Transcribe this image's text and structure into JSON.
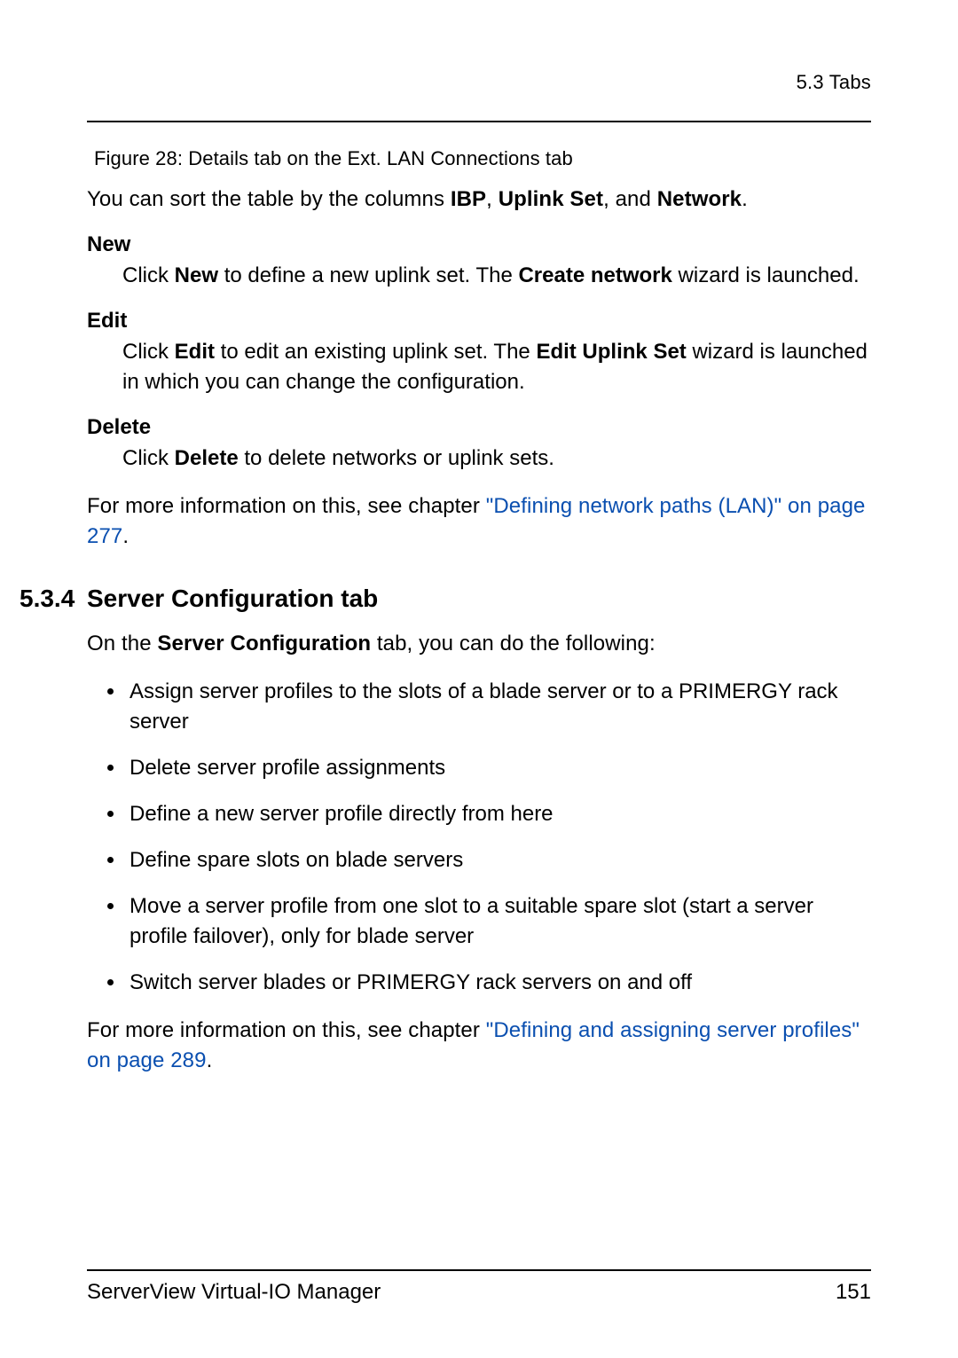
{
  "header": {
    "section_ref": "5.3 Tabs"
  },
  "figure": {
    "caption": "Figure 28: Details tab on the Ext. LAN Connections tab"
  },
  "intro": {
    "prefix": "You can sort the table by the columns ",
    "col1": "IBP",
    "sep1": ", ",
    "col2": "Uplink Set",
    "sep2": ", and ",
    "col3": "Network",
    "suffix": "."
  },
  "defs": {
    "new": {
      "term": "New",
      "pre": "Click ",
      "kw1": "New",
      "mid": " to define a new uplink set. The ",
      "kw2": "Create network",
      "post": " wizard is launched."
    },
    "edit": {
      "term": "Edit",
      "pre": "Click ",
      "kw1": "Edit",
      "mid": " to edit an existing uplink set. The ",
      "kw2": "Edit Uplink Set",
      "post": " wizard is launched in which you can change the configuration."
    },
    "delete": {
      "term": "Delete",
      "pre": "Click ",
      "kw1": "Delete",
      "post": " to delete networks or uplink sets."
    }
  },
  "xref1": {
    "pre": "For more information on this, see chapter ",
    "link": "\"Defining network paths (LAN)\" on page 277",
    "post": "."
  },
  "section": {
    "num": "5.3.4",
    "title": "Server Configuration tab"
  },
  "section_intro": {
    "pre": "On the ",
    "kw": "Server Configuration",
    "post": " tab, you can do the following:"
  },
  "bullets": [
    "Assign server profiles to the slots of a blade server or to a PRIMERGY rack server",
    "Delete server profile assignments",
    "Define a new server profile directly from here",
    "Define spare slots on blade servers",
    "Move a server profile from one slot to a suitable spare slot (start a server profile failover), only for blade server",
    "Switch server blades or PRIMERGY rack servers on and off"
  ],
  "xref2": {
    "pre": "For more information on this, see chapter ",
    "link": "\"Defining and assigning server profiles\" on page 289",
    "post": "."
  },
  "footer": {
    "product": "ServerView Virtual-IO Manager",
    "page": "151"
  }
}
